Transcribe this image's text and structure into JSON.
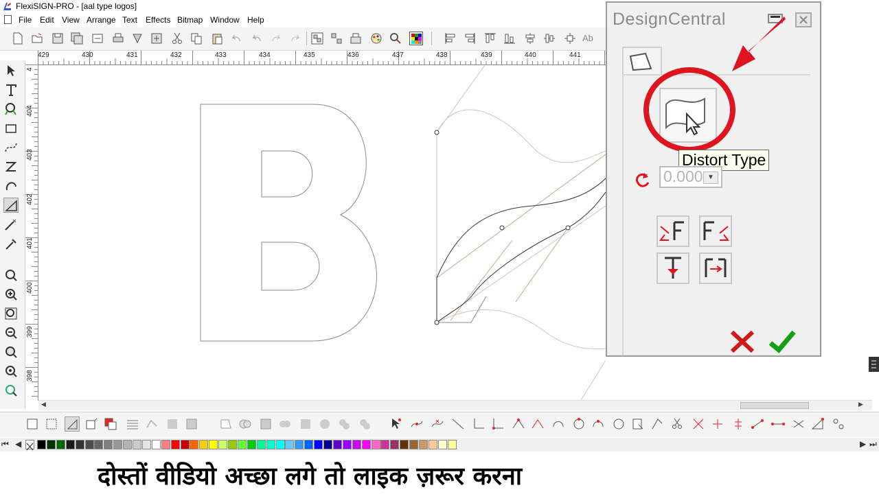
{
  "window": {
    "title": "FlexiSIGN-PRO - [aal type logos]"
  },
  "menu": {
    "items": [
      "File",
      "Edit",
      "View",
      "Arrange",
      "Text",
      "Effects",
      "Bitmap",
      "Window",
      "Help"
    ]
  },
  "toolbar": {
    "text_icon_label": "Ab"
  },
  "ruler": {
    "horizontal": [
      "429",
      "430",
      "431",
      "432",
      "433",
      "434",
      "435",
      "436",
      "437",
      "438",
      "439",
      "440",
      "441"
    ],
    "vertical": [
      "404",
      "403",
      "402",
      "401",
      "400",
      "399",
      "398"
    ],
    "corner_label": "4"
  },
  "design_central": {
    "title": "DesignCentral",
    "tooltip": "Distort Type",
    "angle_value": "0.000",
    "ok_color": "#14a014",
    "cancel_color": "#d01818",
    "highlight_color": "#e0141e"
  },
  "caption": {
    "text": "दोस्तों वीडियो अच्छा लगे तो लाइक ज़रूर करना"
  },
  "palette": {
    "colors": [
      "#000000",
      "#003300",
      "#006600",
      "#1a1a1a",
      "#333333",
      "#4d4d4d",
      "#666666",
      "#808080",
      "#999999",
      "#b3b3b3",
      "#cccccc",
      "#e6e6e6",
      "#ffffff",
      "#ff8080",
      "#ff0000",
      "#cc0000",
      "#ff6600",
      "#ffcc00",
      "#ffff00",
      "#ccff66",
      "#99cc00",
      "#66ff33",
      "#00cc00",
      "#00ff99",
      "#00ffcc",
      "#00ffff",
      "#66ccff",
      "#3399ff",
      "#0066ff",
      "#0000ff",
      "#000099",
      "#6600cc",
      "#9900ff",
      "#cc00ff",
      "#ff00ff",
      "#ff66cc",
      "#cc3399",
      "#993366",
      "#663300",
      "#996633",
      "#cc9966",
      "#ffcc99",
      "#ffffcc",
      "#ffff99"
    ]
  }
}
